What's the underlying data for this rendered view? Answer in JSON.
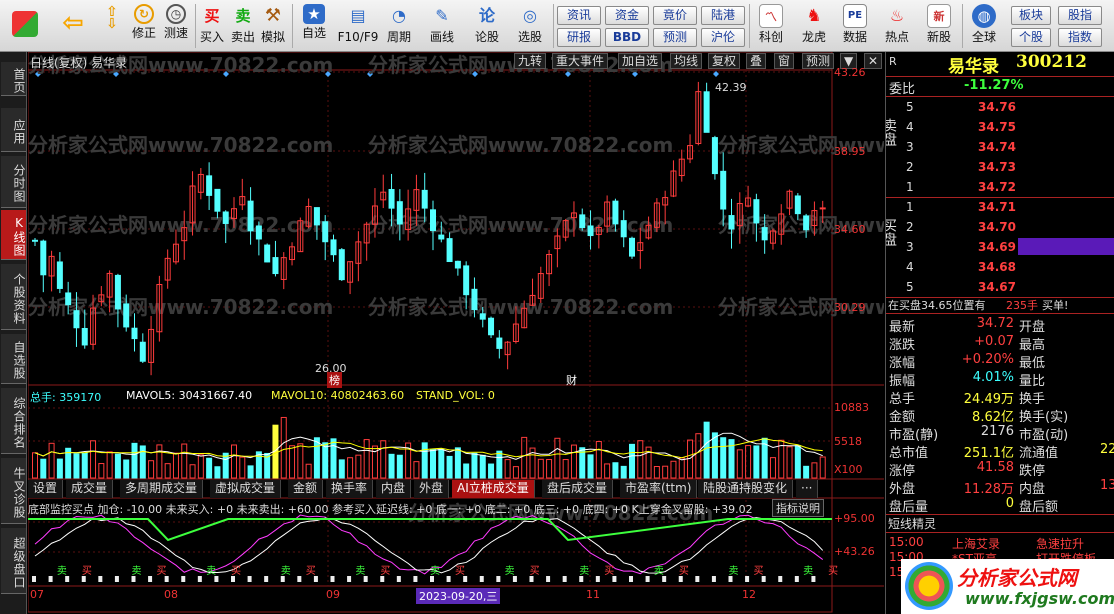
{
  "toolbar": {
    "items": [
      {
        "label": "",
        "icon": "app-grid-icon"
      },
      {
        "label": "",
        "icon": "back-arrow-icon"
      },
      {
        "label": "",
        "icon": "updown-icon"
      },
      {
        "label": "修正",
        "icon": "fix-clock-icon"
      },
      {
        "label": "测速",
        "icon": "speedtest-clock-icon"
      },
      {
        "label": "买入",
        "icon": "buy-icon"
      },
      {
        "label": "卖出",
        "icon": "sell-icon"
      },
      {
        "label": "模拟",
        "icon": "gavel-icon"
      },
      {
        "label": "自选",
        "icon": "star-icon"
      },
      {
        "label": "F10/F9",
        "icon": "f10-icon"
      },
      {
        "label": "周期",
        "icon": "period-icon"
      },
      {
        "label": "画线",
        "icon": "pencil-icon"
      },
      {
        "label": "论股",
        "icon": "discuss-icon"
      },
      {
        "label": "选股",
        "icon": "select-stock-icon"
      }
    ],
    "small_buttons": [
      "资讯",
      "资金",
      "竟价",
      "陆港",
      "研报",
      "BBD",
      "预测",
      "沪伦"
    ],
    "right_items": [
      {
        "label": "科创",
        "icon": "kechuang-icon"
      },
      {
        "label": "龙虎",
        "icon": "dragon-icon"
      },
      {
        "label": "数据",
        "icon": "pe-icon"
      },
      {
        "label": "热点",
        "icon": "hot-icon"
      },
      {
        "label": "新股",
        "icon": "new-stock-icon"
      },
      {
        "label": "全球",
        "icon": "globe-icon"
      }
    ],
    "far_right": [
      "板块",
      "个股",
      "股指",
      "指数"
    ]
  },
  "left_tabs": [
    {
      "label": "首页"
    },
    {
      "label": "应用"
    },
    {
      "label": "分时图"
    },
    {
      "label": "K线图"
    },
    {
      "label": "个股资料"
    },
    {
      "label": "自选股"
    },
    {
      "label": "综合排名"
    },
    {
      "label": "牛叉诊股"
    },
    {
      "label": "超级盘口"
    }
  ],
  "chart": {
    "header": "日线(复权)  易华录",
    "tools": [
      "九转",
      "重大事件",
      "加自选",
      "均线",
      "复权",
      "叠",
      "窗",
      "预测",
      "▼",
      "✕"
    ],
    "watermark": "分析家公式网www.70822.com",
    "price_axis": [
      "43.26",
      "38.95",
      "34.60",
      "30.29"
    ],
    "high_label": "42.39",
    "low_label": "26.00",
    "marker_bang": "榜",
    "marker_cai": "财",
    "volume_legend": {
      "total": "总手: 359170",
      "mavol5": "MAVOL5: 30431667.40",
      "mavol10": "MAVOL10: 40802463.60",
      "stand": "STAND_VOL: 0"
    },
    "volume_axis": [
      "10883",
      "5518",
      "X100"
    ],
    "indicator_tabs": [
      "设置",
      "成交量",
      "多周期成交量",
      "虚拟成交量",
      "金额",
      "换手率",
      "内盘",
      "外盘",
      "AI立桩成交量",
      "盘后成交量",
      "市盈率(ttm)",
      "陆股通持股变化",
      "···"
    ],
    "indicator_legend": "底部监控买点 加仓: -10.00  未来买入: +0  未来卖出: +60.00  参考买入延迟线: +0  底一: +0  底二: +0  底三: +0  底四: +0  K上穿金叉留股: +39.02",
    "indicator_help": "指标说明",
    "indicator_axis": [
      "+95.00",
      "+43.26"
    ],
    "date_axis": [
      "07",
      "08",
      "09",
      "11",
      "12"
    ],
    "date_cursor": "2023-09-20,三",
    "sig_buy": "买",
    "sig_sell": "卖"
  },
  "quote": {
    "r_label": "R",
    "name": "易华录",
    "code": "300212",
    "weibi_label": "委比",
    "weibi": "-11.27%",
    "sell_label": "卖盘",
    "buy_label": "买盘",
    "asks": [
      {
        "lvl": "5",
        "price": "34.76"
      },
      {
        "lvl": "4",
        "price": "34.75"
      },
      {
        "lvl": "3",
        "price": "34.74"
      },
      {
        "lvl": "2",
        "price": "34.73"
      },
      {
        "lvl": "1",
        "price": "34.72"
      }
    ],
    "bids": [
      {
        "lvl": "1",
        "price": "34.71"
      },
      {
        "lvl": "2",
        "price": "34.70"
      },
      {
        "lvl": "3",
        "price": "34.69"
      },
      {
        "lvl": "4",
        "price": "34.68"
      },
      {
        "lvl": "5",
        "price": "34.67"
      }
    ],
    "status_line": "在买盘34.65位置有",
    "status_qty": "235手",
    "status_action": "买单!",
    "stats": [
      {
        "l": "最新",
        "v": "34.72",
        "r": "开盘"
      },
      {
        "l": "涨跌",
        "v": "+0.07",
        "r": "最高"
      },
      {
        "l": "涨幅",
        "v": "+0.20%",
        "r": "最低"
      },
      {
        "l": "振幅",
        "v": "4.01%",
        "r": "量比"
      },
      {
        "l": "总手",
        "v": "24.49万",
        "r": "换手"
      },
      {
        "l": "金额",
        "v": "8.62亿",
        "r": "换手(实)"
      },
      {
        "l": "市盈(静)",
        "v": "2176",
        "r": "市盈(动)"
      },
      {
        "l": "总市值",
        "v": "251.1亿",
        "r": "流通值",
        "rv": "22"
      },
      {
        "l": "涨停",
        "v": "41.58",
        "r": "跌停"
      },
      {
        "l": "外盘",
        "v": "11.28万",
        "r": "内盘",
        "rv": "13"
      },
      {
        "l": "盘后量",
        "v": "0",
        "r": "盘后额"
      }
    ],
    "sprite_title": "短线精灵",
    "sprite_rows": [
      {
        "time": "15:00",
        "name": "上海艾录",
        "event": "急速拉升"
      },
      {
        "time": "15:00",
        "name": "*ST亚高",
        "event": "打开跌停板"
      },
      {
        "time": "15:00",
        "name": "",
        "event": ""
      }
    ],
    "logo_text": "分析家公式网",
    "logo_url": "www.fxjgsw.com"
  },
  "colors": {
    "up": "#ff3c3c",
    "down": "#54ffff",
    "ma5": "#ffffff",
    "ma10": "#ffff00",
    "accent": "#1a3c9a"
  }
}
